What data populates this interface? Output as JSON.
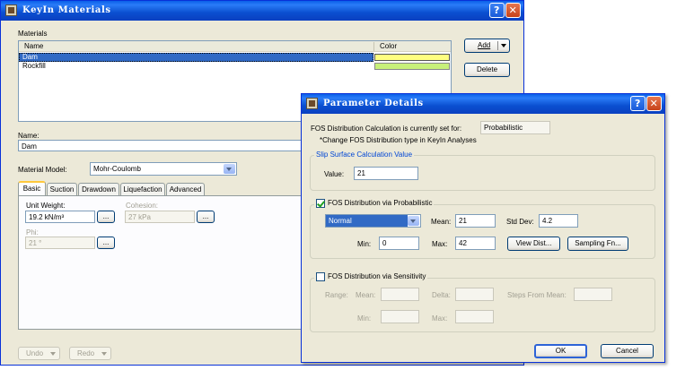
{
  "back_window": {
    "title": "KeyIn Materials",
    "materials_group": "Materials",
    "columns": [
      "Name",
      "Color"
    ],
    "rows": [
      {
        "name": "Dam",
        "color": "#fffe80",
        "selected": true
      },
      {
        "name": "Rockfill",
        "color": "#c8f07a",
        "selected": false
      }
    ],
    "add_label": "Add",
    "delete_label": "Delete",
    "name_label": "Name:",
    "name_value": "Dam",
    "model_label": "Material Model:",
    "model_value": "Mohr-Coulomb",
    "tabs": [
      "Basic",
      "Suction",
      "Drawdown",
      "Liquefaction",
      "Advanced"
    ],
    "unit_weight_label": "Unit Weight:",
    "unit_weight_value": "19.2 kN/m³",
    "cohesion_label": "Cohesion:",
    "cohesion_value": "27 kPa",
    "phi_label": "Phi:",
    "phi_value": "21 °",
    "ellipsis": "...",
    "undo_label": "Undo",
    "redo_label": "Redo"
  },
  "dialog": {
    "title": "Parameter Details",
    "fos_line": "FOS Distribution Calculation is currently set for:",
    "fos_value": "Probabilistic",
    "note": "*Change FOS Distribution type in KeyIn Analyses",
    "slip_group": "Slip Surface Calculation Value",
    "value_label": "Value:",
    "value": "21",
    "prob_group": "FOS Distribution via Probabilistic",
    "prob_checked": true,
    "distribution": "Normal",
    "mean_label": "Mean:",
    "mean": "21",
    "stddev_label": "Std Dev:",
    "stddev": "4.2",
    "min_label": "Min:",
    "min": "0",
    "max_label": "Max:",
    "max": "42",
    "view_dist_label": "View Dist...",
    "sampling_label": "Sampling Fn...",
    "sens_group": "FOS Distribution via Sensitivity",
    "sens_checked": false,
    "range_label": "Range:",
    "sens_mean_label": "Mean:",
    "delta_label": "Delta:",
    "steps_label": "Steps From Mean:",
    "sens_min_label": "Min:",
    "sens_max_label": "Max:",
    "ok_label": "OK",
    "cancel_label": "Cancel"
  },
  "colors": {
    "title_blue": "#0a4fd0",
    "selection": "#316ac5",
    "dialog_face": "#ece9d8"
  }
}
